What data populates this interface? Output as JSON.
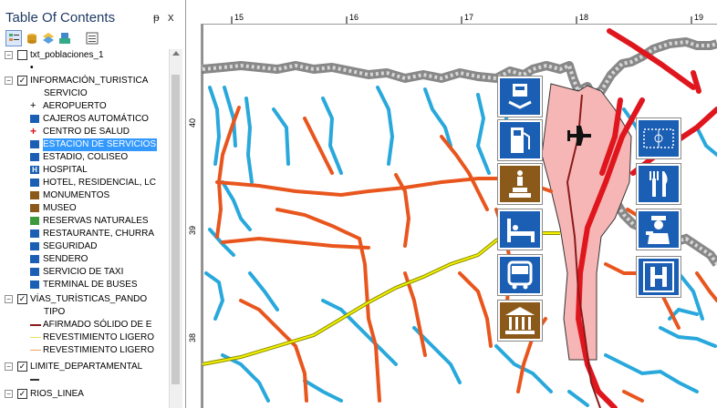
{
  "toc": {
    "title": "Table Of Contents",
    "pin": "ᵽ",
    "close": "x",
    "toolbar_icons": [
      "list-by-drawing-order-icon",
      "list-by-source-icon",
      "list-by-visibility-icon",
      "list-by-selection-icon",
      "options-icon"
    ],
    "items": [
      {
        "label": "txt_poblaciones_1",
        "kind": "layer",
        "checked": false,
        "expander": "−"
      },
      {
        "label": "•",
        "kind": "symbol"
      },
      {
        "label": "INFORMACIÓN_TURISTICA",
        "kind": "layer",
        "checked": true,
        "expander": "−"
      },
      {
        "label": "SERVICIO",
        "kind": "field"
      },
      {
        "label": "AEROPUERTO",
        "kind": "symbol",
        "icon": "airplane-icon"
      },
      {
        "label": "CAJEROS AUTOMÁTICO",
        "kind": "symbol",
        "icon": "atm-icon"
      },
      {
        "label": "CENTRO DE SALUD",
        "kind": "symbol",
        "icon": "health-cross-icon"
      },
      {
        "label": "ESTACION DE SERVICIOS",
        "kind": "symbol",
        "icon": "fuel-icon",
        "selected": true
      },
      {
        "label": "ESTADIO, COLISEO",
        "kind": "symbol",
        "icon": "stadium-icon"
      },
      {
        "label": "HOSPITAL",
        "kind": "symbol",
        "icon": "hospital-icon"
      },
      {
        "label": "HOTEL, RESIDENCIAL, LC",
        "kind": "symbol",
        "icon": "hotel-icon"
      },
      {
        "label": "MONUMENTOS",
        "kind": "symbol",
        "icon": "monument-icon"
      },
      {
        "label": "MUSEO",
        "kind": "symbol",
        "icon": "museum-icon"
      },
      {
        "label": "RESERVAS NATURALES",
        "kind": "symbol",
        "icon": "nature-reserve-icon"
      },
      {
        "label": "RESTAURANTE, CHURRA",
        "kind": "symbol",
        "icon": "restaurant-icon"
      },
      {
        "label": "SEGURIDAD",
        "kind": "symbol",
        "icon": "police-icon"
      },
      {
        "label": "SENDERO",
        "kind": "symbol",
        "icon": "hiking-icon"
      },
      {
        "label": "SERVICIO DE TAXI",
        "kind": "symbol",
        "icon": "taxi-icon"
      },
      {
        "label": "TERMINAL DE BUSES",
        "kind": "symbol",
        "icon": "bus-icon"
      },
      {
        "label": "VÍAS_TURÍSTICAS_PANDO",
        "kind": "layer",
        "checked": true,
        "expander": "−"
      },
      {
        "label": "TIPO",
        "kind": "field"
      },
      {
        "label": "AFIRMADO SÓLIDO DE E",
        "kind": "line",
        "color": "#8b1a1a"
      },
      {
        "label": "REVESTIMIENTO LIGERO",
        "kind": "line",
        "color": "#f0e060"
      },
      {
        "label": "REVESTIMIENTO LIGERO",
        "kind": "line",
        "color": "#f4a460"
      },
      {
        "label": "LIMITE_DEPARTAMENTAL",
        "kind": "layer",
        "checked": true,
        "expander": "−"
      },
      {
        "label": "",
        "kind": "line",
        "color": "#333333"
      },
      {
        "label": "RIOS_LINEA",
        "kind": "layer",
        "checked": true,
        "expander": "−"
      }
    ]
  },
  "ruler": {
    "top_labels": [
      "15",
      "16",
      "17",
      "18",
      "19"
    ],
    "left_labels": [
      "40",
      "39",
      "38"
    ]
  },
  "colors": {
    "river": "#29a8dc",
    "road": "#e8561e",
    "highway": "#e0161e",
    "boundary": "#8c8c8c",
    "urban": "#f7b6b6",
    "trail": "#f2f200",
    "icon_blue": "#1a5fb4",
    "icon_brown": "#8b5a1a"
  },
  "map_icons": [
    {
      "name": "atm-icon",
      "glyph": "ATM"
    },
    {
      "name": "fuel-station-icon",
      "glyph": "⛽"
    },
    {
      "name": "monument-icon",
      "glyph": "♜"
    },
    {
      "name": "hotel-icon",
      "glyph": "🛏"
    },
    {
      "name": "bus-icon",
      "glyph": "🚌"
    },
    {
      "name": "museum-icon",
      "glyph": "🏛"
    },
    {
      "name": "airport-icon",
      "glyph": "✈"
    },
    {
      "name": "stadium-icon",
      "glyph": "⊙"
    },
    {
      "name": "restaurant-icon",
      "glyph": "🍴"
    },
    {
      "name": "police-icon",
      "glyph": "👮"
    },
    {
      "name": "hospital-icon",
      "glyph": "H"
    }
  ]
}
